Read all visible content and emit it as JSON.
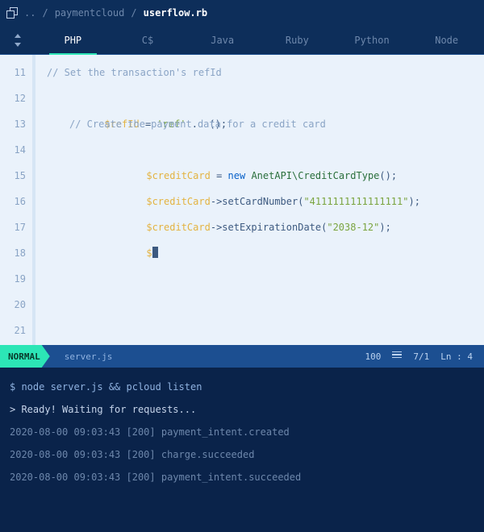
{
  "breadcrumb": {
    "root_icon": "window-stack-icon",
    "dots": "..",
    "sep": "/",
    "folder": "paymentcloud",
    "file": "userflow.rb"
  },
  "tabs": {
    "items": [
      "PHP",
      "C$",
      "Java",
      "Ruby",
      "Python",
      "Node"
    ],
    "active_index": 0
  },
  "gutter": [
    "11",
    "12",
    "13",
    "14",
    "15",
    "16",
    "17",
    "18",
    "19",
    "20",
    "21"
  ],
  "code": {
    "l0_comment": "// Set the transaction's refId",
    "l1_var": "$refId",
    "l1_eq": " = ",
    "l1_str": "'ref'",
    "l1_rest": " .  ();",
    "l2_comment": "// Create the payment data for a credit card",
    "l3_var": "$creditCard",
    "l3_eq": " = ",
    "l3_kw": "new",
    "l3_sp": " ",
    "l3_type": "AnetAPI\\CreditCardType",
    "l3_tail": "();",
    "l4_var": "$creditCard",
    "l4_call": "->setCardNumber(",
    "l4_str": "\"4111111111111111\"",
    "l4_tail": ");",
    "l5_var": "$creditCard",
    "l5_call": "->setExpirationDate(",
    "l5_str": "\"2038-12\"",
    "l5_tail": ");",
    "l6_var": "$"
  },
  "status": {
    "mode": "NORMAL",
    "file": "server.js",
    "right_a": "100",
    "right_b": "7/1",
    "right_c": "Ln : 4"
  },
  "terminal": {
    "lines": [
      "$ node server.js && pcloud listen",
      "> Ready! Waiting for requests...",
      "2020-08-00 09:03:43 [200] payment_intent.created",
      "2020-08-00 09:03:43 [200] charge.succeeded",
      "2020-08-00 09:03:43 [200] payment_intent.succeeded"
    ]
  }
}
